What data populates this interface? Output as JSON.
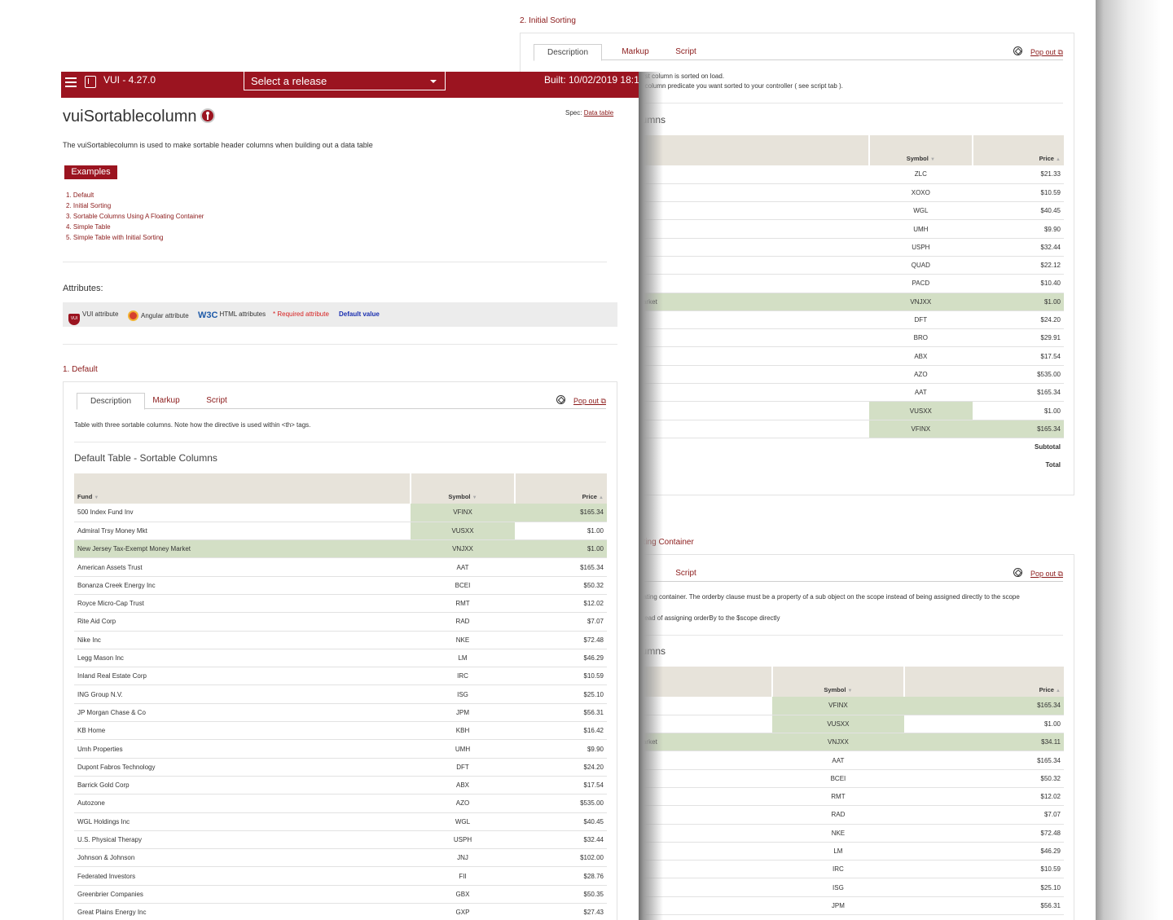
{
  "back_window": {
    "initial_sorting": {
      "heading": "2. Initial Sorting",
      "tabs": [
        "Description",
        "Markup",
        "Script"
      ],
      "popout": "Pop out",
      "desc_line1": "first column is sorted on load.",
      "desc_line2": "e column predicate you want sorted to your controller ( see script tab ).",
      "table_title": "lumns",
      "columns": {
        "symbol": "Symbol",
        "price": "Price"
      },
      "rows": [
        {
          "fund": "",
          "symbol": "ZLC",
          "price": "$21.33"
        },
        {
          "fund": "",
          "symbol": "XOXO",
          "price": "$10.59"
        },
        {
          "fund": "",
          "symbol": "WGL",
          "price": "$40.45"
        },
        {
          "fund": "",
          "symbol": "UMH",
          "price": "$9.90"
        },
        {
          "fund": "",
          "symbol": "USPH",
          "price": "$32.44"
        },
        {
          "fund": "",
          "symbol": "QUAD",
          "price": "$22.12"
        },
        {
          "fund": "",
          "symbol": "PACD",
          "price": "$10.40"
        },
        {
          "fund": "arket",
          "symbol": "VNJXX",
          "price": "$1.00"
        },
        {
          "fund": "",
          "symbol": "DFT",
          "price": "$24.20"
        },
        {
          "fund": "",
          "symbol": "BRO",
          "price": "$29.91"
        },
        {
          "fund": "",
          "symbol": "ABX",
          "price": "$17.54"
        },
        {
          "fund": "",
          "symbol": "AZO",
          "price": "$535.00"
        },
        {
          "fund": "",
          "symbol": "AAT",
          "price": "$165.34"
        },
        {
          "fund": "",
          "symbol": "VUSXX",
          "price": "$1.00"
        },
        {
          "fund": "",
          "symbol": "VFINX",
          "price": "$165.34"
        }
      ],
      "subtotal": "Subtotal",
      "total": "Total"
    },
    "floating": {
      "heading": "ating Container",
      "tab_script": "Script",
      "popout": "Pop out",
      "desc_line1": "oating container. The orderby clause must be a property of a sub object on the scope instead of being assigned directly to the scope",
      "desc_line2": "stead of assigning orderBy to the $scope directly",
      "table_title": "lumns",
      "columns": {
        "symbol": "Symbol",
        "price": "Price"
      },
      "rows": [
        {
          "fund": "",
          "symbol": "VFINX",
          "price": "$165.34"
        },
        {
          "fund": "",
          "symbol": "VUSXX",
          "price": "$1.00"
        },
        {
          "fund": "arket",
          "symbol": "VNJXX",
          "price": "$34.11"
        },
        {
          "fund": "",
          "symbol": "AAT",
          "price": "$165.34"
        },
        {
          "fund": "",
          "symbol": "BCEI",
          "price": "$50.32"
        },
        {
          "fund": "",
          "symbol": "RMT",
          "price": "$12.02"
        },
        {
          "fund": "",
          "symbol": "RAD",
          "price": "$7.07"
        },
        {
          "fund": "",
          "symbol": "NKE",
          "price": "$72.48"
        },
        {
          "fund": "",
          "symbol": "LM",
          "price": "$46.29"
        },
        {
          "fund": "",
          "symbol": "IRC",
          "price": "$10.59"
        },
        {
          "fund": "",
          "symbol": "ISG",
          "price": "$25.10"
        },
        {
          "fund": "",
          "symbol": "JPM",
          "price": "$56.31"
        }
      ]
    }
  },
  "front_window": {
    "topbar": {
      "version": "VUI - 4.27.0",
      "release_select": "Select a release",
      "built": "Built: 10/02/2019 18:11"
    },
    "page_title": "vuiSortablecolumn",
    "spec_label": "Spec:",
    "spec_link": "Data table",
    "intro": "The vuiSortablecolumn is used to make sortable header columns when building out a data table",
    "examples_button": "Examples",
    "examples": [
      "1. Default",
      "2. Initial Sorting",
      "3. Sortable Columns Using A Floating Container",
      "4. Simple Table",
      "5. Simple Table with Initial Sorting"
    ],
    "attributes_title": "Attributes:",
    "legend": {
      "vui": "VUI attribute",
      "angular": "Angular attribute",
      "html": "HTML attributes",
      "required": "* Required attribute",
      "default": "Default value"
    },
    "default_section": {
      "heading": "1. Default",
      "tabs": [
        "Description",
        "Markup",
        "Script"
      ],
      "popout": "Pop out",
      "description": "Table with three sortable columns. Note how the directive is used within <th> tags.",
      "table_title": "Default Table - Sortable Columns",
      "columns": {
        "fund": "Fund",
        "symbol": "Symbol",
        "price": "Price"
      },
      "rows": [
        {
          "fund": "500 Index Fund Inv",
          "symbol": "VFINX",
          "price": "$165.34"
        },
        {
          "fund": "Admiral Trsy Money Mkt",
          "symbol": "VUSXX",
          "price": "$1.00"
        },
        {
          "fund": "New Jersey Tax-Exempt Money Market",
          "symbol": "VNJXX",
          "price": "$1.00"
        },
        {
          "fund": "American Assets Trust",
          "symbol": "AAT",
          "price": "$165.34"
        },
        {
          "fund": "Bonanza Creek Energy Inc",
          "symbol": "BCEI",
          "price": "$50.32"
        },
        {
          "fund": "Royce Micro-Cap Trust",
          "symbol": "RMT",
          "price": "$12.02"
        },
        {
          "fund": "Rite Aid Corp",
          "symbol": "RAD",
          "price": "$7.07"
        },
        {
          "fund": "Nike Inc",
          "symbol": "NKE",
          "price": "$72.48"
        },
        {
          "fund": "Legg Mason Inc",
          "symbol": "LM",
          "price": "$46.29"
        },
        {
          "fund": "Inland Real Estate Corp",
          "symbol": "IRC",
          "price": "$10.59"
        },
        {
          "fund": "ING Group N.V.",
          "symbol": "ISG",
          "price": "$25.10"
        },
        {
          "fund": "JP Morgan Chase & Co",
          "symbol": "JPM",
          "price": "$56.31"
        },
        {
          "fund": "KB Home",
          "symbol": "KBH",
          "price": "$16.42"
        },
        {
          "fund": "Umh Properties",
          "symbol": "UMH",
          "price": "$9.90"
        },
        {
          "fund": "Dupont Fabros Technology",
          "symbol": "DFT",
          "price": "$24.20"
        },
        {
          "fund": "Barrick Gold Corp",
          "symbol": "ABX",
          "price": "$17.54"
        },
        {
          "fund": "Autozone",
          "symbol": "AZO",
          "price": "$535.00"
        },
        {
          "fund": "WGL Holdings Inc",
          "symbol": "WGL",
          "price": "$40.45"
        },
        {
          "fund": "U.S. Physical Therapy",
          "symbol": "USPH",
          "price": "$32.44"
        },
        {
          "fund": "Johnson & Johnson",
          "symbol": "JNJ",
          "price": "$102.00"
        },
        {
          "fund": "Federated Investors",
          "symbol": "FII",
          "price": "$28.76"
        },
        {
          "fund": "Greenbrier Companies",
          "symbol": "GBX",
          "price": "$50.35"
        },
        {
          "fund": "Great Plains Energy Inc",
          "symbol": "GXP",
          "price": "$27.43"
        }
      ]
    }
  },
  "colors": {
    "brand": "#9b1420",
    "link": "#8b1a1a",
    "header_bg": "#e7e3da",
    "highlight": "#d3dfc5",
    "legend_bg": "#ececec"
  }
}
